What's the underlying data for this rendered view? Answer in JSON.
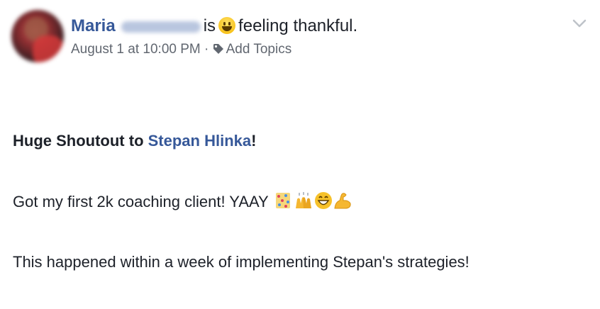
{
  "post": {
    "author_first_name": "Maria",
    "status_verb": "is",
    "feeling_text": "feeling thankful.",
    "timestamp": "August 1 at 10:00 PM",
    "separator": "·",
    "topics_label": "Add Topics",
    "icons": {
      "feeling": "smiley-face-icon",
      "topics": "tag-icon",
      "menu": "chevron-down-icon",
      "reactions": [
        "party-popper-icon",
        "raising-hands-icon",
        "grinning-face-icon",
        "flexed-biceps-icon"
      ]
    },
    "body": {
      "line1_prefix": "Huge Shoutout to ",
      "line1_mention": "Stepan Hlinka",
      "line1_suffix": "!",
      "line2_text": "Got my first 2k coaching client! YAAY",
      "line3_text": "This happened within a week of implementing Stepan's strategies!"
    }
  },
  "colors": {
    "link": "#365899",
    "text": "#1d2129",
    "meta": "#616770"
  }
}
